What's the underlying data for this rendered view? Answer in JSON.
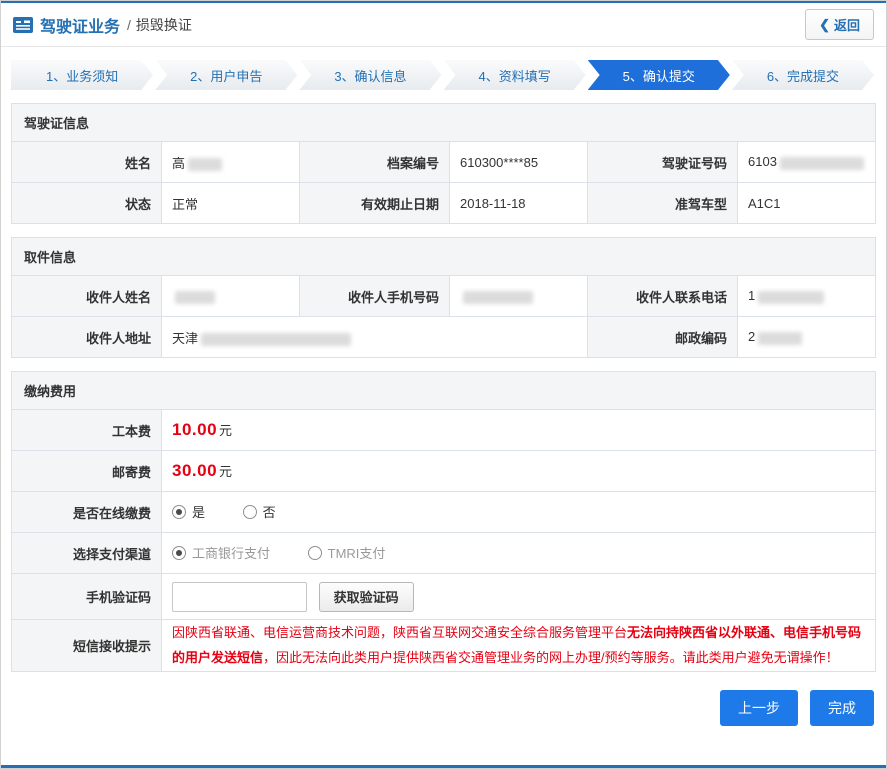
{
  "colors": {
    "accent": "#2470b3",
    "active_step": "#1e6fd9",
    "danger": "#e60012",
    "primary_button": "#1d7ae8"
  },
  "header": {
    "title": "驾驶证业务",
    "separator": "/",
    "subtitle": "损毁换证",
    "back_icon": "❮",
    "back_label": "返回"
  },
  "steps": [
    "1、业务须知",
    "2、用户申告",
    "3、确认信息",
    "4、资料填写",
    "5、确认提交",
    "6、完成提交"
  ],
  "license": {
    "title": "驾驶证信息",
    "row1": {
      "l1": "姓名",
      "v1": "高",
      "l2": "档案编号",
      "v2": "610300****85",
      "l3": "驾驶证号码",
      "v3": "6103"
    },
    "row2": {
      "l1": "状态",
      "v1": "正常",
      "l2": "有效期止日期",
      "v2": "2018-11-18",
      "l3": "准驾车型",
      "v3": "A1C1"
    }
  },
  "pickup": {
    "title": "取件信息",
    "row1": {
      "l1": "收件人姓名",
      "v1": "",
      "l2": "收件人手机号码",
      "v2": "",
      "l3": "收件人联系电话",
      "v3": "1"
    },
    "row2": {
      "l1": "收件人地址",
      "v1": "天津",
      "l2": "邮政编码",
      "v2": "2"
    }
  },
  "payment": {
    "title": "缴纳费用",
    "fee1_label": "工本费",
    "fee1_value": "10.00",
    "fee2_label": "邮寄费",
    "fee2_value": "30.00",
    "fee_unit": "元",
    "online_label": "是否在线缴费",
    "online_yes": "是",
    "online_no": "否",
    "channel_label": "选择支付渠道",
    "channel_icbc": "工商银行支付",
    "channel_tmri": "TMRI支付",
    "code_label": "手机验证码",
    "code_button": "获取验证码",
    "notice_label": "短信接收提示",
    "notice_part1": "因陕西省联通、电信运营商技术问题，陕西省互联网交通安全综合服务管理平台",
    "notice_part2": "无法向持陕西省以外联通、电信手机号码的用户发送短信",
    "notice_part3": "，因此无法向此类用户提供陕西省交通管理业务的网上办理/预约等服务。请此类用户避免无谓操作！"
  },
  "footer": {
    "prev_label": "上一步",
    "finish_label": "完成"
  }
}
